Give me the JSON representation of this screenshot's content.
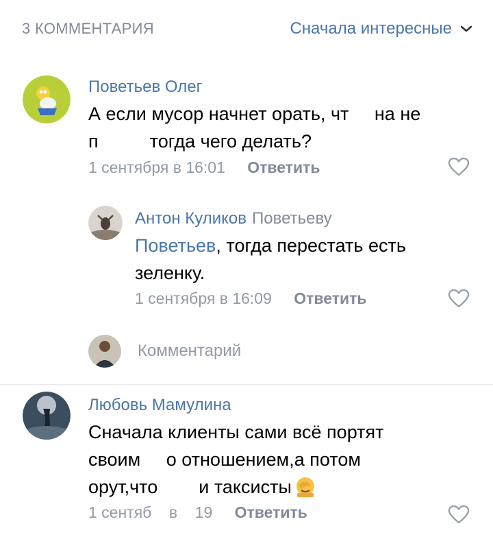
{
  "header": {
    "count_label": "3 КОММЕНТАРИЯ",
    "sort_label": "Сначала интересные"
  },
  "comments": [
    {
      "author": "Поветьев Олег",
      "text_line1": "А если мусор начнет орать, чт     на не",
      "text_line2": "п          тогда чего делать?",
      "date": "1 сентября в 16:01",
      "reply_label": "Ответить"
    },
    {
      "author": "Антон Куликов",
      "reply_to": "Поветьеву",
      "mention": "Поветьев",
      "text_rest": ", тогда перестать есть",
      "text_line2": "зеленку.",
      "date": "1 сентября в 16:09",
      "reply_label": "Ответить"
    },
    {
      "author": "Любовь Мамулина",
      "text_line1": "Сначала клиенты сами всё портят",
      "text_line2": "своим     о отношением,а потом",
      "text_line3": "орут,что        и таксисты",
      "date": "1 сентяб    в    19",
      "reply_label": "Ответить"
    }
  ],
  "comment_input": {
    "placeholder": "Комментарий"
  },
  "colors": {
    "link": "#4a76a8",
    "secondary": "#828a99",
    "text": "#000000"
  },
  "icons": [
    "chevron-down-icon",
    "heart-icon",
    "facepalm-emoji-icon"
  ]
}
